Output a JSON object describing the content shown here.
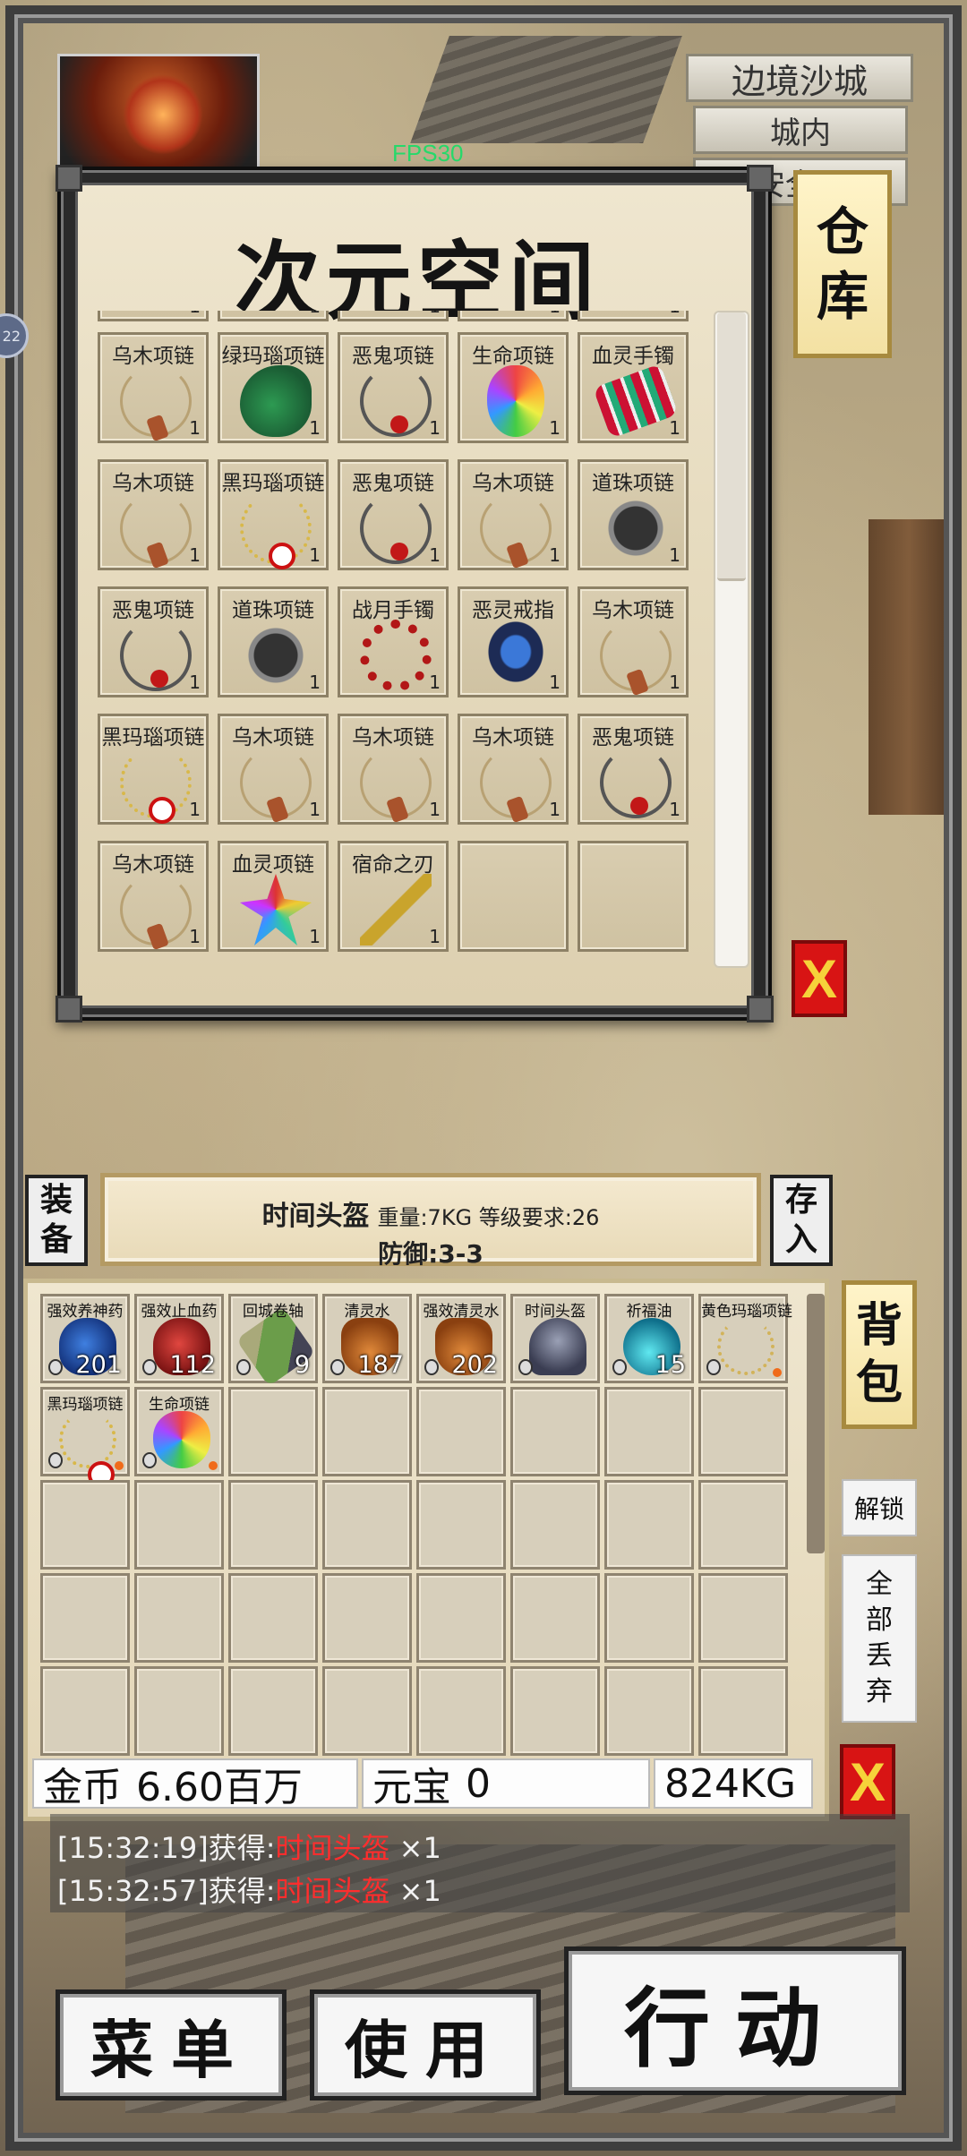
{
  "hud": {
    "fps": "FPS30",
    "location": [
      "边境沙城",
      "城内",
      "安全区"
    ],
    "side_chip": "22"
  },
  "warehouse": {
    "title": "次元空间",
    "tab_label": [
      "仓",
      "库"
    ],
    "close_label": "X",
    "partial_counts": [
      "1",
      "1",
      "1",
      "1",
      "1"
    ],
    "items": [
      {
        "name": "乌木项链",
        "count": "1",
        "icon": "wooden-necklace"
      },
      {
        "name": "绿玛瑙项链",
        "count": "1",
        "icon": "green-agate-necklace"
      },
      {
        "name": "恶鬼项链",
        "count": "1",
        "icon": "evil-ghost-necklace"
      },
      {
        "name": "生命项链",
        "count": "1",
        "icon": "life-necklace"
      },
      {
        "name": "血灵手镯",
        "count": "1",
        "icon": "blood-spirit-bracelet"
      },
      {
        "name": "乌木项链",
        "count": "1",
        "icon": "wooden-necklace"
      },
      {
        "name": "黑玛瑙项链",
        "count": "1",
        "icon": "black-agate-necklace"
      },
      {
        "name": "恶鬼项链",
        "count": "1",
        "icon": "evil-ghost-necklace"
      },
      {
        "name": "乌木项链",
        "count": "1",
        "icon": "wooden-necklace"
      },
      {
        "name": "道珠项链",
        "count": "1",
        "icon": "taoist-bead-necklace"
      },
      {
        "name": "恶鬼项链",
        "count": "1",
        "icon": "evil-ghost-necklace"
      },
      {
        "name": "道珠项链",
        "count": "1",
        "icon": "taoist-bead-necklace"
      },
      {
        "name": "战月手镯",
        "count": "1",
        "icon": "war-moon-bracelet"
      },
      {
        "name": "恶灵戒指",
        "count": "1",
        "icon": "evil-spirit-ring"
      },
      {
        "name": "乌木项链",
        "count": "1",
        "icon": "wooden-necklace"
      },
      {
        "name": "黑玛瑙项链",
        "count": "1",
        "icon": "black-agate-necklace"
      },
      {
        "name": "乌木项链",
        "count": "1",
        "icon": "wooden-necklace"
      },
      {
        "name": "乌木项链",
        "count": "1",
        "icon": "wooden-necklace"
      },
      {
        "name": "乌木项链",
        "count": "1",
        "icon": "wooden-necklace"
      },
      {
        "name": "恶鬼项链",
        "count": "1",
        "icon": "evil-ghost-necklace"
      },
      {
        "name": "乌木项链",
        "count": "1",
        "icon": "wooden-necklace"
      },
      {
        "name": "血灵项链",
        "count": "1",
        "icon": "blood-spirit-necklace"
      },
      {
        "name": "宿命之刃",
        "count": "1",
        "icon": "fate-blade"
      },
      {
        "name": "",
        "count": "",
        "icon": ""
      },
      {
        "name": "",
        "count": "",
        "icon": ""
      }
    ]
  },
  "info": {
    "equip_label": [
      "装",
      "备"
    ],
    "store_label": [
      "存",
      "入"
    ],
    "item_name": "时间头盔",
    "item_meta": "重量:7KG 等级要求:26",
    "item_stat": "防御:3-3"
  },
  "bag": {
    "tab_label": [
      "背",
      "包"
    ],
    "unlock_label": "解锁",
    "drop_all_label": [
      "全",
      "部",
      "丢",
      "弃"
    ],
    "close_label": "X",
    "items": [
      {
        "name": "强效养神药",
        "count": "201",
        "icon": "blue-potion",
        "dot": false
      },
      {
        "name": "强效止血药",
        "count": "112",
        "icon": "red-potion",
        "dot": false
      },
      {
        "name": "回城卷轴",
        "count": "9",
        "icon": "town-scroll",
        "dot": false
      },
      {
        "name": "清灵水",
        "count": "187",
        "icon": "spirit-water",
        "dot": false
      },
      {
        "name": "强效清灵水",
        "count": "202",
        "icon": "spirit-water",
        "dot": false
      },
      {
        "name": "时间头盔",
        "count": "",
        "icon": "helmet",
        "dot": false
      },
      {
        "name": "祈福油",
        "count": "15",
        "icon": "blessing-oil",
        "dot": false
      },
      {
        "name": "黄色玛瑙项链",
        "count": "",
        "icon": "yellow-agate-necklace",
        "dot": true
      },
      {
        "name": "黑玛瑙项链",
        "count": "",
        "icon": "black-agate-necklace",
        "dot": true
      },
      {
        "name": "生命项链",
        "count": "",
        "icon": "life-necklace",
        "dot": true
      }
    ],
    "total_slots": 40
  },
  "wallet": {
    "gold_label": "金币",
    "gold_value": "6.60百万",
    "yuanbao_label": "元宝",
    "yuanbao_value": "0",
    "weight": "824KG"
  },
  "log": [
    {
      "time": "[15:32:19]获得:",
      "item": "时间头盔",
      "qty": "×1"
    },
    {
      "time": "[15:32:57]获得:",
      "item": "时间头盔",
      "qty": "×1"
    }
  ],
  "buttons": {
    "menu": "菜单",
    "use": "使用",
    "action": "行动"
  },
  "colors": {
    "close_red": "#d81414",
    "log_item_red": "#ff2d2d",
    "fps_green": "#26d96a",
    "tab_gold": "#f3e1a3"
  }
}
